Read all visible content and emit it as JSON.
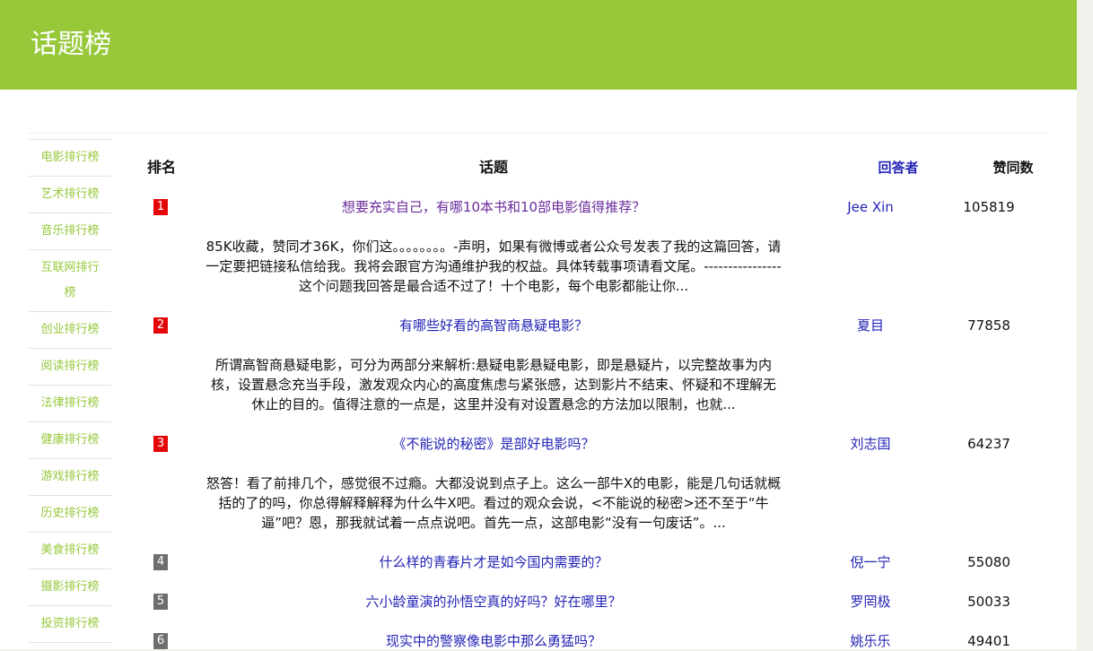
{
  "header": {
    "title": "话题榜"
  },
  "colors": {
    "header_bg": "#96c83a",
    "sidebar_link": "#96c83a",
    "link": "#2323b6",
    "visited_link": "#6a2c9c",
    "rank_top": "#e3070a",
    "rank_other": "#6e6e6e"
  },
  "sidebar": {
    "items": [
      {
        "label": "电影排行榜"
      },
      {
        "label": "艺术排行榜"
      },
      {
        "label": "音乐排行榜"
      },
      {
        "label": "互联网排行榜"
      },
      {
        "label": "创业排行榜"
      },
      {
        "label": "阅读排行榜"
      },
      {
        "label": "法律排行榜"
      },
      {
        "label": "健康排行榜"
      },
      {
        "label": "游戏排行榜"
      },
      {
        "label": "历史排行榜"
      },
      {
        "label": "美食排行榜"
      },
      {
        "label": "摄影排行榜"
      },
      {
        "label": "投资排行榜"
      }
    ]
  },
  "table": {
    "headers": {
      "rank": "排名",
      "topic": "话题",
      "answerer": "回答者",
      "votes": "赞同数"
    },
    "rows": [
      {
        "rank": "1",
        "title": "想要充实自己，有哪10本书和10部电影值得推荐？",
        "answerer": "Jee Xin",
        "votes": "105819",
        "excerpt": "85K收藏，赞同才36K，你们这。。。。。。。。-声明，如果有微博或者公众号发表了我的这篇回答，请一定要把链接私信给我。我将会跟官方沟通维护我的权益。具体转载事项请看文尾。----------------这个问题我回答是最合适不过了！十个电影，每个电影都能让你..."
      },
      {
        "rank": "2",
        "title": "有哪些好看的高智商悬疑电影？",
        "answerer": "夏目",
        "votes": "77858",
        "excerpt": "所谓高智商悬疑电影，可分为两部分来解析:悬疑电影悬疑电影，即是悬疑片，以完整故事为内核，设置悬念充当手段，激发观众内心的高度焦虑与紧张感，达到影片不结束、怀疑和不理解无休止的目的。值得注意的一点是，这里并没有对设置悬念的方法加以限制，也就..."
      },
      {
        "rank": "3",
        "title": "《不能说的秘密》是部好电影吗？",
        "answerer": "刘志国",
        "votes": "64237",
        "excerpt": "怒答！看了前排几个，感觉很不过瘾。大都没说到点子上。这么一部牛X的电影，能是几句话就概括的了的吗，你总得解释解释为什么牛X吧。看过的观众会说，<不能说的秘密>还不至于“牛逼”吧？恩，那我就试着一点点说吧。首先一点，这部电影“没有一句废话”。..."
      },
      {
        "rank": "4",
        "title": "什么样的青春片才是如今国内需要的？",
        "answerer": "倪一宁",
        "votes": "55080"
      },
      {
        "rank": "5",
        "title": "六小龄童演的孙悟空真的好吗？好在哪里？",
        "answerer": "罗罔极",
        "votes": "50033"
      },
      {
        "rank": "6",
        "title": "现实中的警察像电影中那么勇猛吗？",
        "answerer": "姚乐乐",
        "votes": "49401"
      }
    ]
  }
}
